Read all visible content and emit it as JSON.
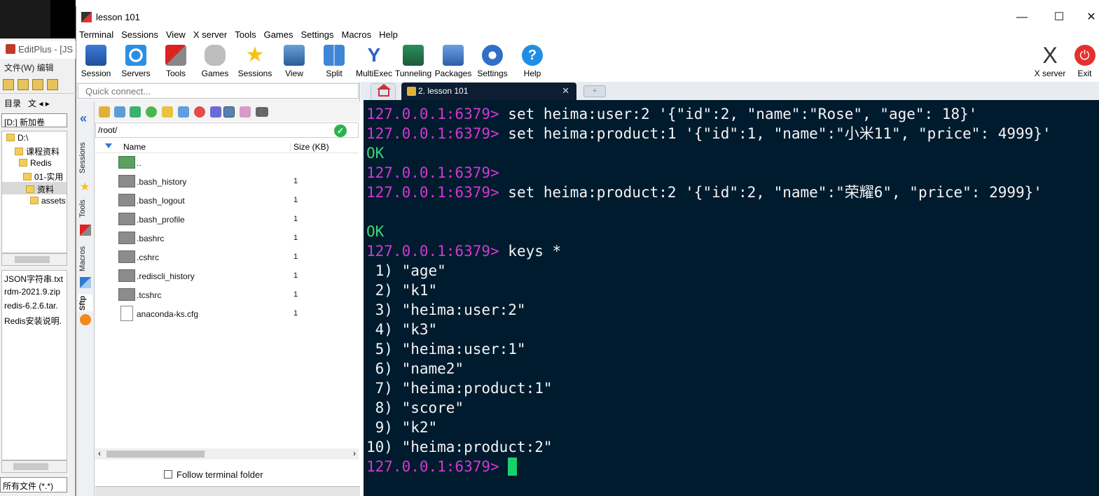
{
  "editplus": {
    "title": "EditPlus - [JS",
    "menu": "文件(W)  编辑",
    "tab_label": "目录",
    "tab_label2": "文",
    "drive": "[D:] 新加卷",
    "tree": [
      "D:\\",
      "课程资料",
      "Redis",
      "01-实用",
      "资料",
      "assets"
    ],
    "files": [
      "JSON字符串.txt",
      "rdm-2021.9.zip",
      "redis-6.2.6.tar.",
      "Redis安装说明."
    ],
    "filter": "所有文件 (*.*)"
  },
  "window": {
    "title": "lesson 101",
    "minimize": "—",
    "maximize": "☐",
    "close": "✕"
  },
  "menu": [
    "Terminal",
    "Sessions",
    "View",
    "X server",
    "Tools",
    "Games",
    "Settings",
    "Macros",
    "Help"
  ],
  "toolbar": {
    "buttons": [
      "Session",
      "Servers",
      "Tools",
      "Games",
      "Sessions",
      "View",
      "Split",
      "MultiExec",
      "Tunneling",
      "Packages",
      "Settings",
      "Help"
    ],
    "right": [
      "X server",
      "Exit"
    ]
  },
  "quick_connect": {
    "placeholder": "Quick connect..."
  },
  "vertical_tabs": [
    "Sessions",
    "Tools",
    "Macros",
    "Sftp"
  ],
  "sftp": {
    "path": "/root/",
    "col_name": "Name",
    "col_size": "Size (KB)",
    "files": [
      {
        "name": "..",
        "size": ""
      },
      {
        "name": ".bash_history",
        "size": "1"
      },
      {
        "name": ".bash_logout",
        "size": "1"
      },
      {
        "name": ".bash_profile",
        "size": "1"
      },
      {
        "name": ".bashrc",
        "size": "1"
      },
      {
        "name": ".cshrc",
        "size": "1"
      },
      {
        "name": ".rediscli_history",
        "size": "1"
      },
      {
        "name": ".tcshrc",
        "size": "1"
      },
      {
        "name": "anaconda-ks.cfg",
        "size": "1"
      }
    ],
    "follow_label": "Follow terminal folder"
  },
  "tabs": {
    "active": "2. lesson 101",
    "close": "✕",
    "plus": "+"
  },
  "terminal": {
    "prompt": "127.0.0.1:6379>",
    "lines": [
      {
        "type": "cmd",
        "text": " set heima:user:2 '{\"id\":2, \"name\":\"Rose\", \"age\": 18}'"
      },
      {
        "type": "cmd",
        "text": " set heima:product:1 '{\"id\":1, \"name\":\"小米11\", \"price\": 4999}'"
      },
      {
        "type": "ok",
        "text": "OK"
      },
      {
        "type": "cmd",
        "text": ""
      },
      {
        "type": "cmd",
        "text": " set heima:product:2 '{\"id\":2, \"name\":\"荣耀6\", \"price\": 2999}'"
      },
      {
        "type": "blank",
        "text": ""
      },
      {
        "type": "ok",
        "text": "OK"
      },
      {
        "type": "cmd",
        "text": " keys *"
      },
      {
        "type": "out",
        "text": " 1) \"age\""
      },
      {
        "type": "out",
        "text": " 2) \"k1\""
      },
      {
        "type": "out",
        "text": " 3) \"heima:user:2\""
      },
      {
        "type": "out",
        "text": " 4) \"k3\""
      },
      {
        "type": "out",
        "text": " 5) \"heima:user:1\""
      },
      {
        "type": "out",
        "text": " 6) \"name2\""
      },
      {
        "type": "out",
        "text": " 7) \"heima:product:1\""
      },
      {
        "type": "out",
        "text": " 8) \"score\""
      },
      {
        "type": "out",
        "text": " 9) \"k2\""
      },
      {
        "type": "out",
        "text": "10) \"heima:product:2\""
      },
      {
        "type": "cmdcur",
        "text": " "
      }
    ]
  }
}
